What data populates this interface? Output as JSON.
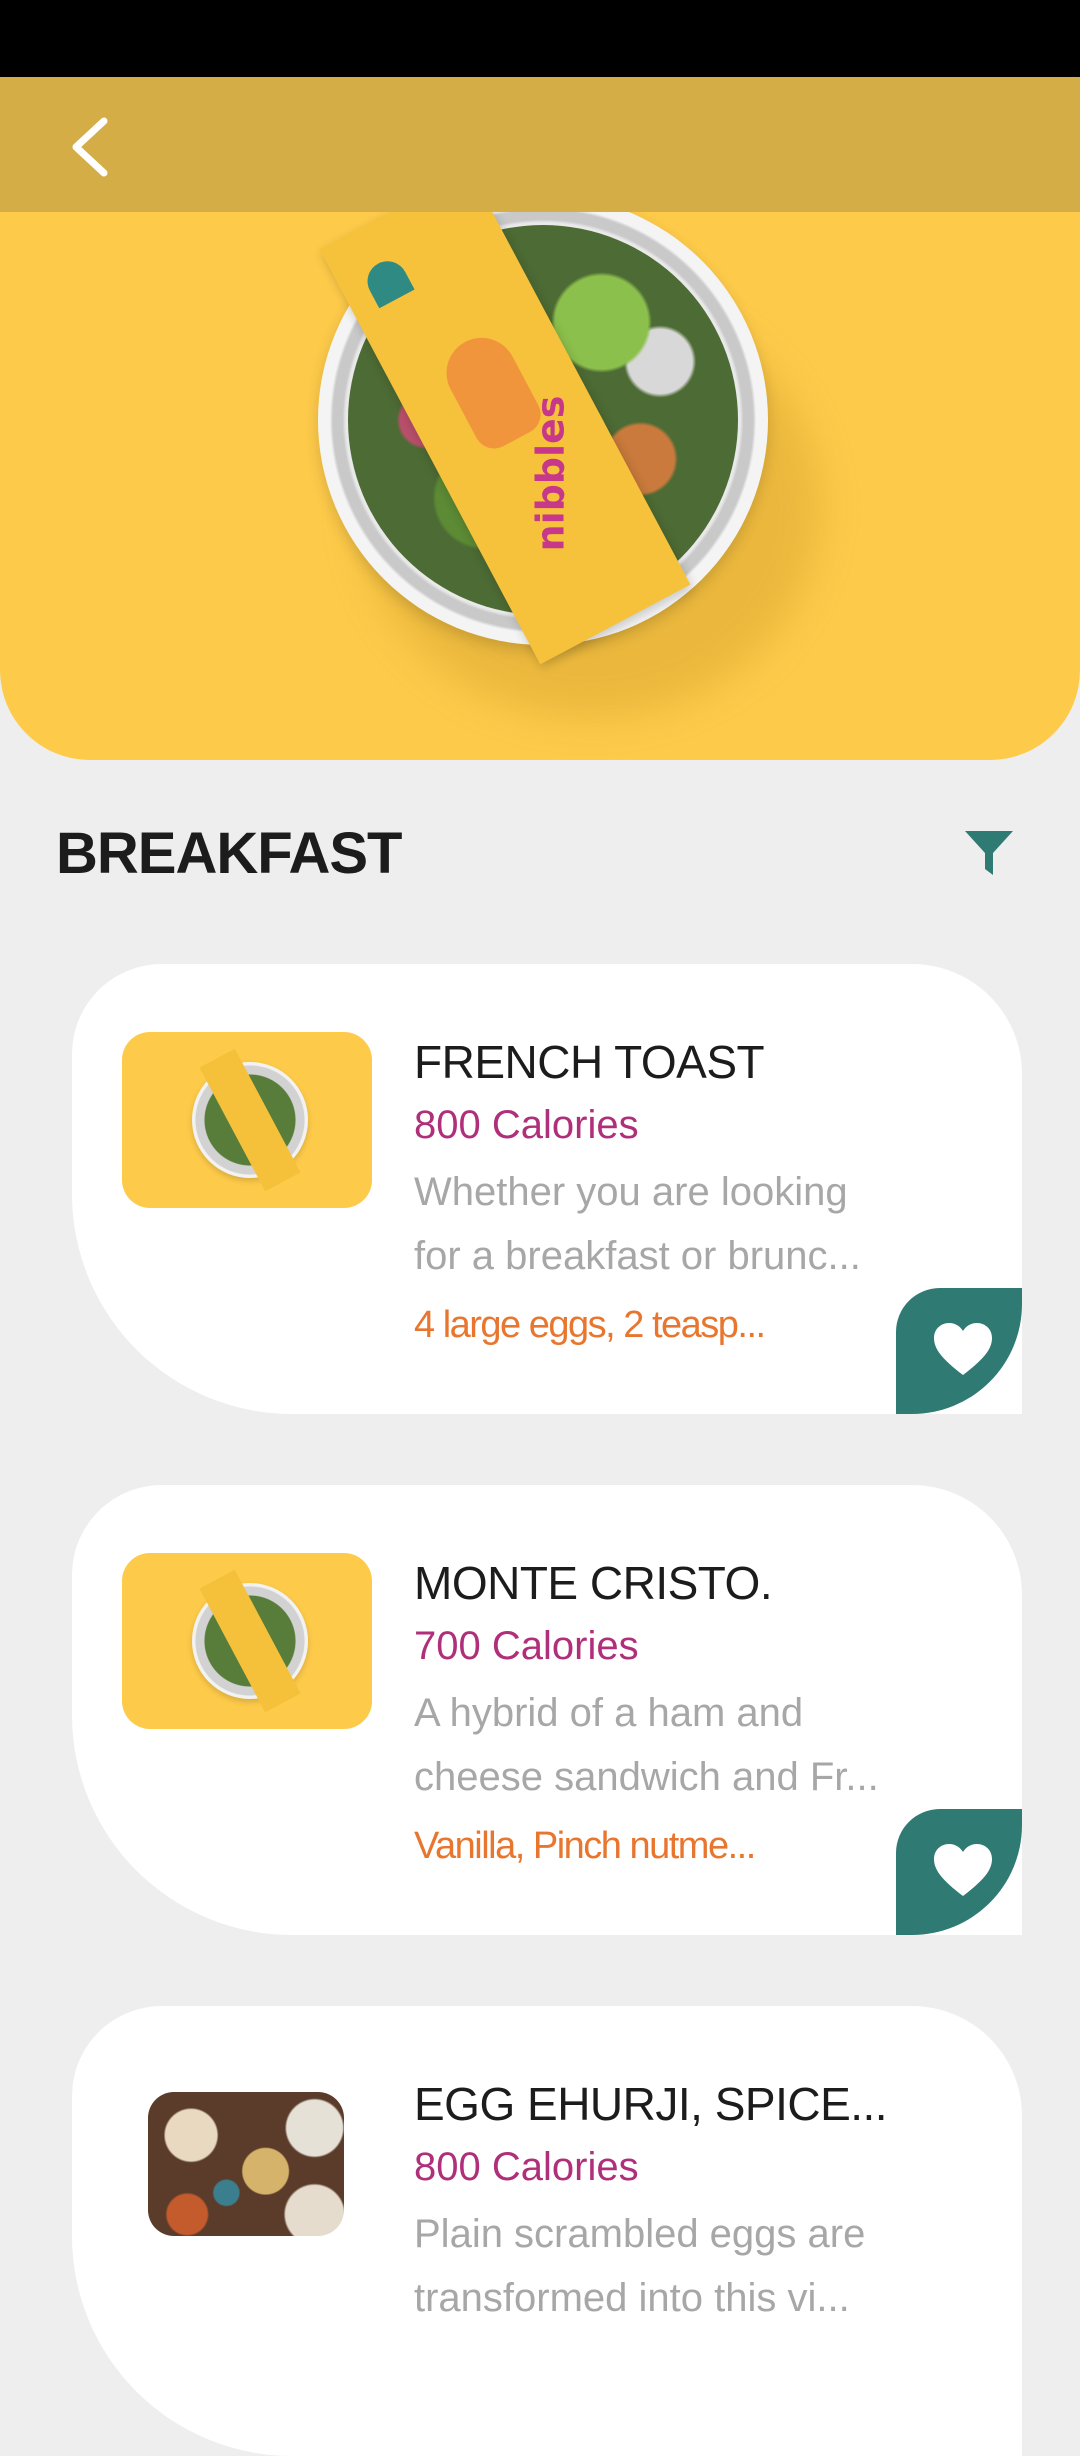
{
  "section": {
    "title": "BREAKFAST"
  },
  "hero": {
    "brand_text": "nibbles"
  },
  "colors": {
    "accent_yellow": "#fdca4a",
    "app_bar": "#d4ad46",
    "calories": "#b02f7a",
    "ingredients": "#e8762e",
    "favorite": "#2f7a73"
  },
  "icons": {
    "back": "chevron-left-icon",
    "filter": "filter-icon",
    "favorite": "heart-icon"
  },
  "recipes": [
    {
      "title": "FRENCH TOAST",
      "calories": "800 Calories",
      "description": "Whether you are looking for a breakfast or brunc...",
      "ingredients": "4 large eggs, 2 teasp..."
    },
    {
      "title": "MONTE CRISTO.",
      "calories": "700 Calories",
      "description": "A hybrid of a ham and cheese sandwich and Fr...",
      "ingredients": "Vanilla, Pinch nutme..."
    },
    {
      "title": "EGG EHURJI, SPICE...",
      "calories": "800 Calories",
      "description": "Plain scrambled eggs are transformed into this vi...",
      "ingredients": ""
    }
  ]
}
